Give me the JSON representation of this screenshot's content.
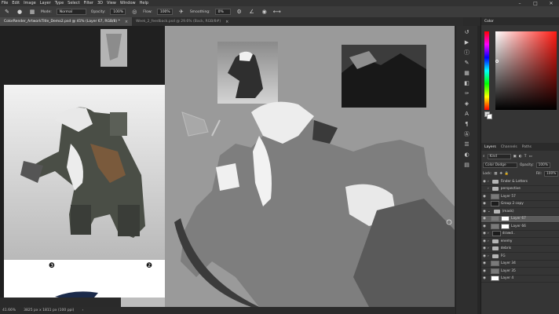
{
  "menubar": {
    "items": [
      "File",
      "Edit",
      "Image",
      "Layer",
      "Type",
      "Select",
      "Filter",
      "3D",
      "View",
      "Window",
      "Help"
    ],
    "controls": {
      "minimize": "–",
      "maximize": "□",
      "close": "✕"
    }
  },
  "options": {
    "mode_label": "Mode:",
    "mode_value": "Normal",
    "opacity_label": "Opacity:",
    "opacity_value": "100%",
    "flow_label": "Flow:",
    "flow_value": "100%",
    "smoothing_label": "Smoothing:",
    "smoothing_value": "0%"
  },
  "tabs": [
    {
      "label": "ColorRender_ArtworkTitle_Demo2.psd @ 41% (Layer 67, RGB/8) *",
      "close": "×",
      "active": true
    },
    {
      "label": "Week_2_feedback.psd @ 29.6% (Back, RGB/8#)",
      "close": "×",
      "active": false
    }
  ],
  "canvas": {
    "badge_left": "❸",
    "badge_right": "❷",
    "colors": {
      "canvas_bg": "#9a9a9a",
      "left_doc_top": "#f2f2f2",
      "left_doc_bottom": "#b9b9b9"
    }
  },
  "statusbar": {
    "zoom": "41.66%",
    "doc_info": "3825 px x 1811 px (100 ppi)",
    "arrow": "›"
  },
  "color_panel": {
    "tabs": [
      "Color"
    ],
    "accent_red": "#ff1a12"
  },
  "layers_panel": {
    "tabs": [
      "Layers",
      "Channels",
      "Paths"
    ],
    "filter_label": "Kind",
    "blend_mode": "Color Dodge",
    "opacity_label": "Opacity:",
    "opacity_value": "100%",
    "lock_label": "Lock:",
    "fill_label": "Fill:",
    "fill_value": "100%",
    "layers": [
      {
        "name": "Finder & Letters",
        "kind": "folder",
        "selected": false
      },
      {
        "name": "perspective",
        "kind": "folder",
        "selected": false
      },
      {
        "name": "Layer 57",
        "kind": "layer",
        "thumb": "mid",
        "selected": false
      },
      {
        "name": "Group 2 copy",
        "kind": "layer",
        "thumb": "dark",
        "selected": false
      },
      {
        "name": "(mask)",
        "kind": "folder",
        "selected": false
      },
      {
        "name": "Layer 67",
        "kind": "layer-mask",
        "thumb": "mid",
        "selected": true
      },
      {
        "name": "Layer 66",
        "kind": "layer-mask",
        "thumb": "mid",
        "selected": false
      },
      {
        "name": "drawd..",
        "kind": "layer",
        "thumb": "dark",
        "selected": false
      },
      {
        "name": "enemy",
        "kind": "folder",
        "selected": false
      },
      {
        "name": "debris",
        "kind": "folder",
        "selected": false
      },
      {
        "name": "FG",
        "kind": "folder",
        "selected": false
      },
      {
        "name": "Layer 34",
        "kind": "layer",
        "thumb": "mid",
        "selected": false
      },
      {
        "name": "Layer 35",
        "kind": "layer",
        "thumb": "mid",
        "selected": false
      },
      {
        "name": "Layer 4",
        "kind": "layer",
        "thumb": "white",
        "selected": false
      }
    ],
    "footer_icons": [
      "link-icon",
      "fx-icon",
      "mask-icon",
      "adjust-icon",
      "folder-icon",
      "new-layer-icon",
      "trash-icon"
    ]
  },
  "toolstrip": {
    "icons": [
      "history-icon",
      "play-icon",
      "info-icon",
      "brush-icon",
      "swatch-icon",
      "clone-icon",
      "path-icon",
      "3d-icon",
      "type-icon",
      "paragraph-icon",
      "char-icon",
      "properties-icon",
      "adjust-icon",
      "libraries-icon"
    ]
  }
}
